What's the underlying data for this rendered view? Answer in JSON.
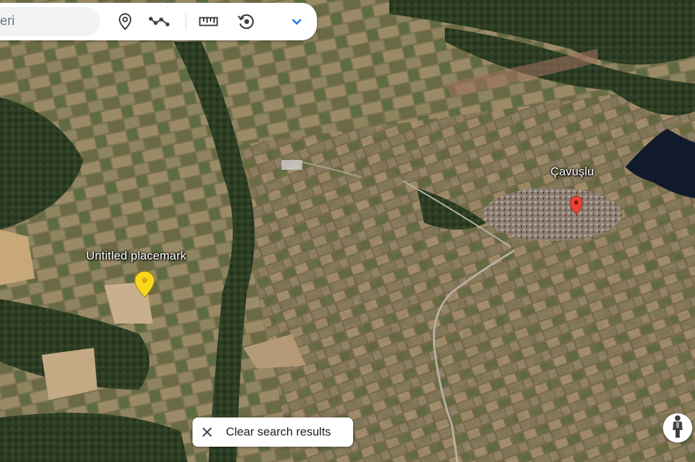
{
  "search": {
    "value": "eri"
  },
  "toolbar": {
    "icons": [
      "place-pin-icon",
      "route-path-icon",
      "ruler-icon",
      "history-icon",
      "chevron-down-icon"
    ],
    "accent_color": "#1a73e8"
  },
  "map": {
    "labels": {
      "placemark": "Untitled placemark",
      "town": "Çavuşlu"
    },
    "pins": {
      "placemark_color": "#f9d71c",
      "town_color": "#ea4335"
    }
  },
  "clear_search": {
    "label": "Clear search results"
  },
  "street_view": {
    "icon": "pegman-icon"
  }
}
